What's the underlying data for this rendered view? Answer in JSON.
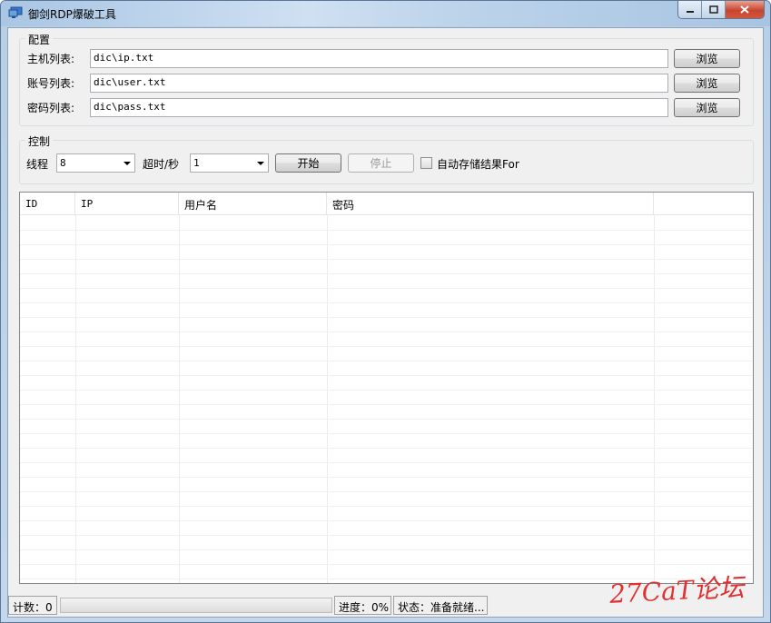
{
  "window": {
    "title": "御剑RDP爆破工具"
  },
  "config": {
    "group_label": "配置",
    "rows": [
      {
        "label": "主机列表:",
        "value": "dic\\ip.txt",
        "browse": "浏览"
      },
      {
        "label": "账号列表:",
        "value": "dic\\user.txt",
        "browse": "浏览"
      },
      {
        "label": "密码列表:",
        "value": "dic\\pass.txt",
        "browse": "浏览"
      }
    ]
  },
  "control": {
    "group_label": "控制",
    "threads_label": "线程",
    "threads_value": "8",
    "timeout_label": "超时/秒",
    "timeout_value": "1",
    "start_label": "开始",
    "stop_label": "停止",
    "autosave_label": "自动存储结果For",
    "autosave_checked": false
  },
  "results": {
    "columns": [
      "ID",
      "IP",
      "用户名",
      "密码"
    ]
  },
  "status": {
    "count": "计数：0",
    "progress_fraction": 0,
    "progress_text": "进度：0%",
    "state": "状态：准备就绪..."
  },
  "watermark": "27CaT论坛",
  "colors": {
    "progress_fill": "#37b41f",
    "close_button": "#c9452d",
    "watermark": "#e03030"
  }
}
